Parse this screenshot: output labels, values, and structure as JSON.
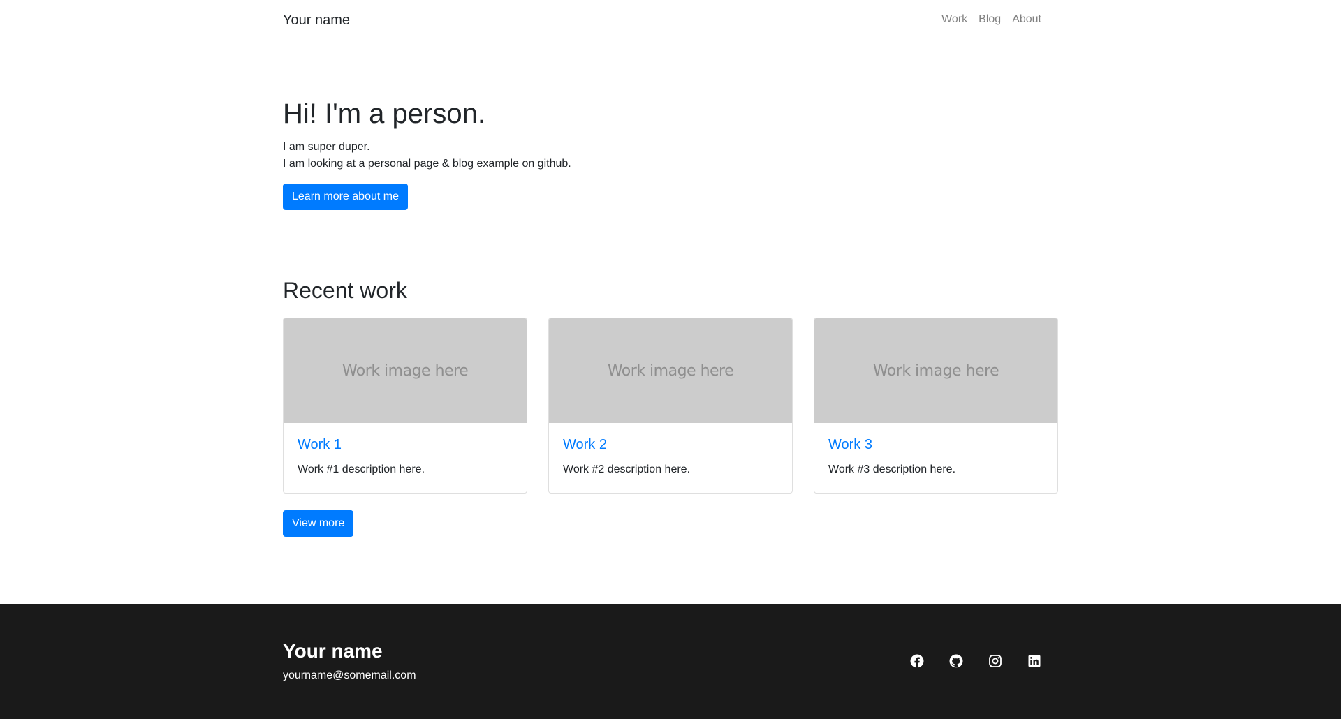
{
  "navbar": {
    "brand": "Your name",
    "links": [
      "Work",
      "Blog",
      "About"
    ]
  },
  "hero": {
    "title": "Hi! I'm a person.",
    "line1": "I am super duper.",
    "line2": "I am looking at a personal page & blog example on github.",
    "button": "Learn more about me"
  },
  "recent": {
    "title": "Recent work",
    "cards": [
      {
        "image_text": "Work image here",
        "title": "Work 1",
        "description": "Work #1 description here."
      },
      {
        "image_text": "Work image here",
        "title": "Work 2",
        "description": "Work #2 description here."
      },
      {
        "image_text": "Work image here",
        "title": "Work 3",
        "description": "Work #3 description here."
      }
    ],
    "button": "View more"
  },
  "footer": {
    "name": "Your name",
    "email": "yourname@somemail.com",
    "social_icons": [
      "facebook-icon",
      "github-icon",
      "instagram-icon",
      "linkedin-icon"
    ]
  },
  "colors": {
    "accent": "#007bff",
    "footer_bg": "#1a1a1a",
    "placeholder_bg": "#cccccc"
  }
}
